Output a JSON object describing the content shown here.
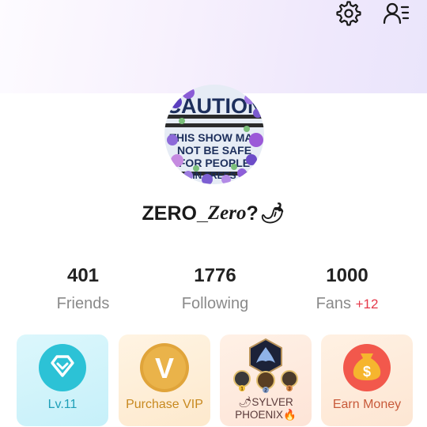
{
  "icons": {
    "settings": "gear-icon",
    "contacts": "user-list-icon",
    "pepper": "chili-pepper-icon",
    "fire": "fire-icon"
  },
  "avatar": {
    "lines": [
      "CAUTION",
      "THIS SHOW MAY",
      "NOT BE SAFE",
      "FOR PEOPLE",
      "IN TREES"
    ]
  },
  "profile": {
    "name_prefix": "ZERO_",
    "name_italic": "Zero",
    "name_suffix": "?",
    "pepper_glyph": "🌶"
  },
  "stats": {
    "friends": {
      "value": "401",
      "label": "Friends"
    },
    "following": {
      "value": "1776",
      "label": "Following"
    },
    "fans": {
      "value": "1000",
      "label": "Fans",
      "delta": "+12"
    }
  },
  "cards": {
    "level": {
      "label": "Lv.11"
    },
    "vip": {
      "label": "Purchase VIP",
      "glyph": "V"
    },
    "family": {
      "line1": "🌶SYLVER",
      "line2": "PHOENIX🔥",
      "ranks": [
        "1",
        "2",
        "3"
      ]
    },
    "earn": {
      "label": "Earn Money",
      "glyph": "$"
    }
  },
  "colors": {
    "accent_red": "#e5394a",
    "level_teal": "#2cc2d6",
    "vip_gold": "#e0a43a",
    "earn_red": "#f2584c"
  }
}
